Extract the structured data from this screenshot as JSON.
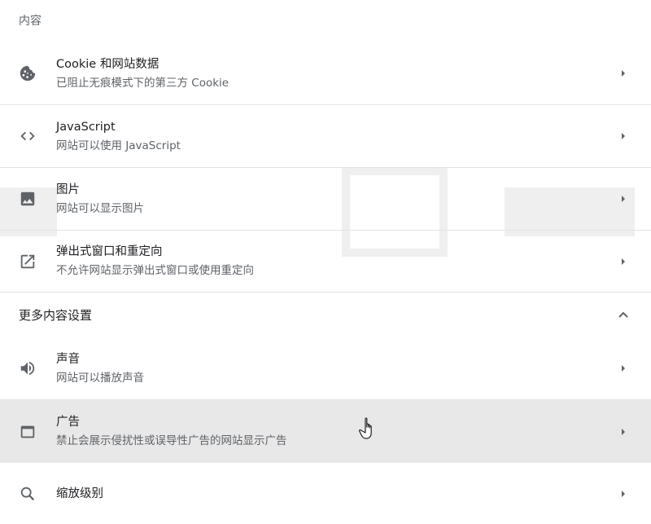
{
  "section_content": "内容",
  "rows_top": [
    {
      "icon": "cookie-icon",
      "title": "Cookie 和网站数据",
      "subtitle": "已阻止无痕模式下的第三方 Cookie"
    },
    {
      "icon": "code-icon",
      "title": "JavaScript",
      "subtitle": "网站可以使用 JavaScript"
    },
    {
      "icon": "image-icon",
      "title": "图片",
      "subtitle": "网站可以显示图片"
    },
    {
      "icon": "open-in-new-icon",
      "title": "弹出式窗口和重定向",
      "subtitle": "不允许网站显示弹出式窗口或使用重定向"
    }
  ],
  "more_settings": {
    "title": "更多内容设置",
    "expanded": true
  },
  "rows_more": [
    {
      "icon": "volume-icon",
      "title": "声音",
      "subtitle": "网站可以播放声音"
    },
    {
      "icon": "ads-window-icon",
      "title": "广告",
      "subtitle": "禁止会展示侵扰性或误导性广告的网站显示广告"
    },
    {
      "icon": "zoom-search-icon",
      "title": "缩放级别",
      "subtitle": ""
    }
  ],
  "colors": {
    "text_primary": "#202124",
    "text_secondary": "#5f6368",
    "icon": "#5f6368",
    "hover_row": "#e8e8e8",
    "divider": "#e3e3e3"
  }
}
